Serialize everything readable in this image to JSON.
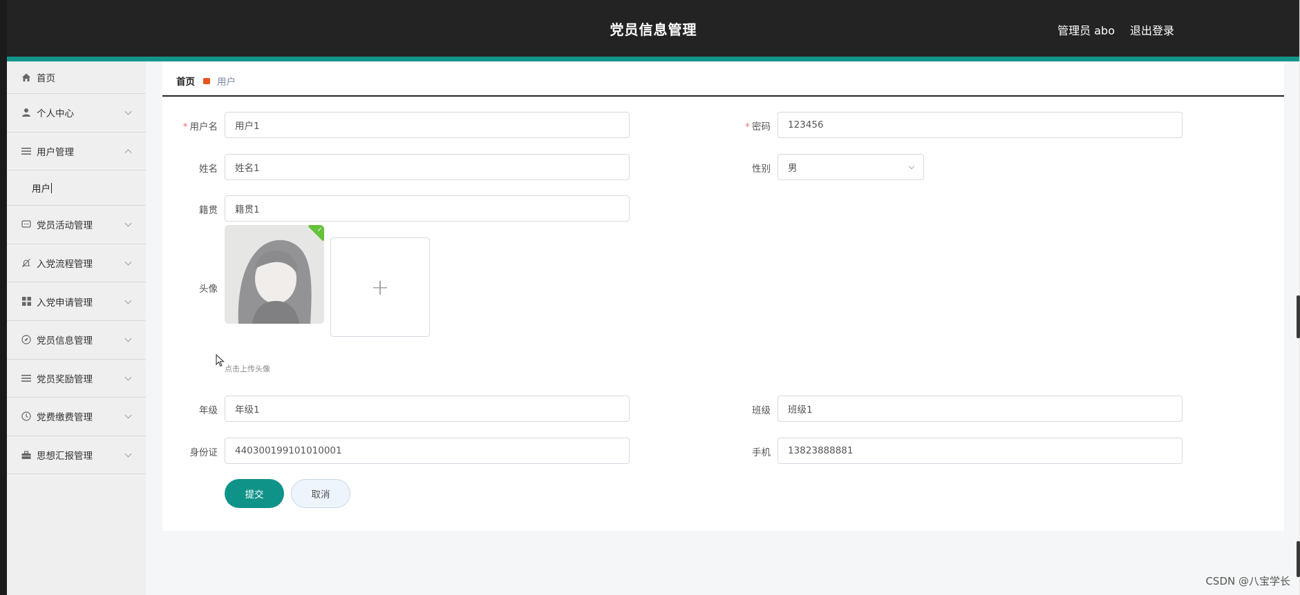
{
  "header": {
    "title": "党员信息管理",
    "user": "管理员 abo",
    "logout": "退出登录"
  },
  "sidebar": {
    "home": "首页",
    "items": [
      {
        "label": "个人中心",
        "icon": "user-icon"
      },
      {
        "label": "用户管理",
        "icon": "menu-icon",
        "expanded": true
      },
      {
        "label": "党员活动管理",
        "icon": "chat-icon"
      },
      {
        "label": "入党流程管理",
        "icon": "bell-off-icon"
      },
      {
        "label": "入党申请管理",
        "icon": "grid-icon"
      },
      {
        "label": "党员信息管理",
        "icon": "compass-icon"
      },
      {
        "label": "党员奖励管理",
        "icon": "menu-icon"
      },
      {
        "label": "党费缴费管理",
        "icon": "clock-icon"
      },
      {
        "label": "思想汇报管理",
        "icon": "suitcase-icon"
      }
    ],
    "sub_item": "用户"
  },
  "breadcrumb": {
    "home": "首页",
    "current": "用户"
  },
  "form": {
    "username": {
      "label": "用户名",
      "value": "用户1",
      "required": true
    },
    "password": {
      "label": "密码",
      "value": "123456",
      "required": true
    },
    "name": {
      "label": "姓名",
      "value": "姓名1"
    },
    "gender": {
      "label": "性别",
      "value": "男"
    },
    "hometown": {
      "label": "籍贯",
      "value": "籍贯1"
    },
    "avatar": {
      "label": "头像",
      "tip": "点击上传头像",
      "plus": "+"
    },
    "grade": {
      "label": "年级",
      "value": "年级1"
    },
    "class": {
      "label": "班级",
      "value": "班级1"
    },
    "id_card": {
      "label": "身份证",
      "value": "440300199101010001"
    },
    "phone": {
      "label": "手机",
      "value": "13823888881"
    },
    "required_mark": "*"
  },
  "buttons": {
    "submit": "提交",
    "cancel": "取消"
  },
  "watermark": "CSDN @八宝学长",
  "colors": {
    "accent": "#14948a",
    "header": "#232323",
    "required": "#f56c6c",
    "breadcrumb_sep": "#e8541c"
  }
}
